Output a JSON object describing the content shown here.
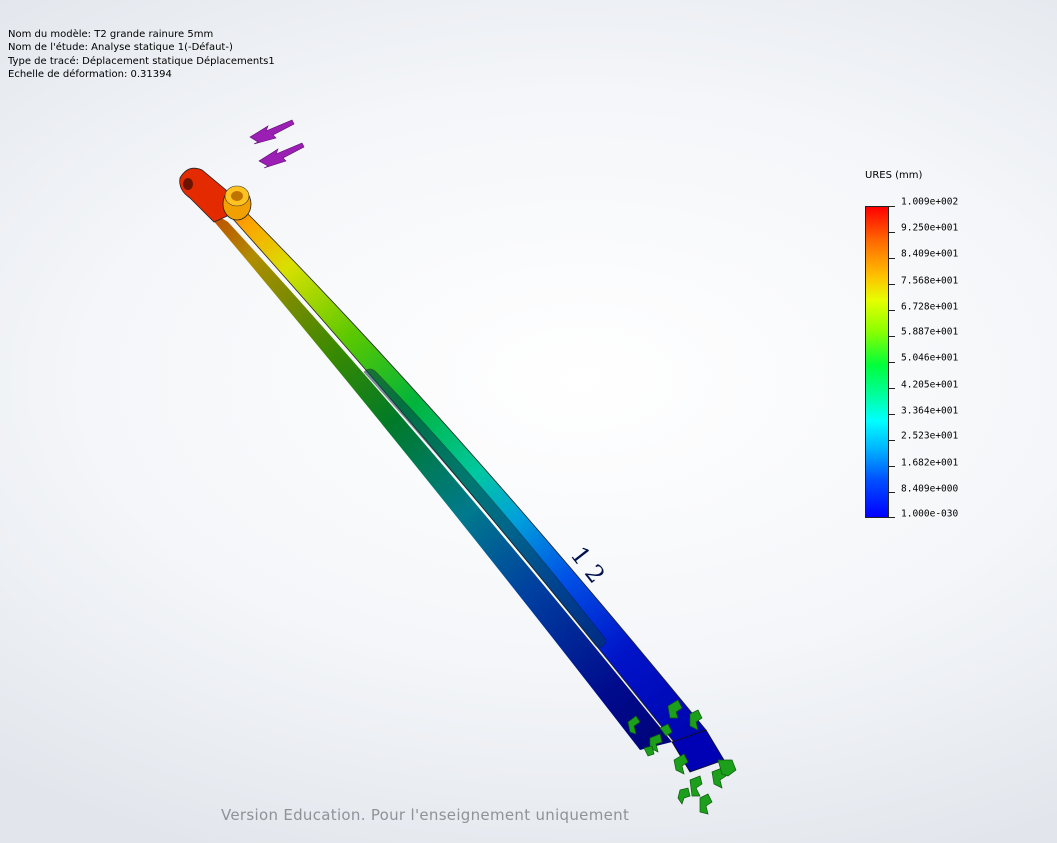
{
  "info": {
    "model_name": "Nom du modèle: T2 grande rainure 5mm",
    "study_name": "Nom de l'étude: Analyse statique 1(-Défaut-)",
    "plot_type": "Type de tracé: Déplacement statique Déplacements1",
    "deformation_scale": "Echelle de déformation: 0.31394"
  },
  "legend": {
    "title": "URES (mm)",
    "ticks": [
      "1.009e+002",
      "9.250e+001",
      "8.409e+001",
      "7.568e+001",
      "6.728e+001",
      "5.887e+001",
      "5.046e+001",
      "4.205e+001",
      "3.364e+001",
      "2.523e+001",
      "1.682e+001",
      "8.409e+000",
      "1.000e-030"
    ],
    "max_color": "#ff0000",
    "min_color": "#0000ff"
  },
  "part": {
    "engraved_text": "1 2"
  },
  "icons": {
    "load": "force-arrow-icon",
    "fixture": "fixed-geometry-icon"
  },
  "watermark": "Version Education. Pour l'enseignement uniquement"
}
